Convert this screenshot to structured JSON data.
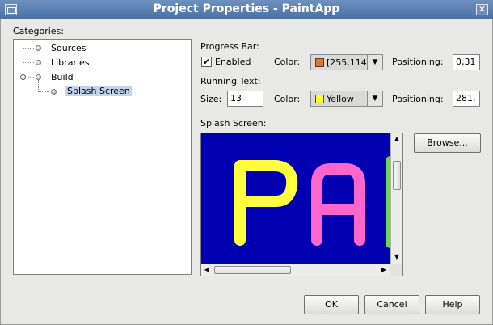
{
  "window": {
    "title": "Project Properties - PaintApp",
    "close_glyph": "✕"
  },
  "categories": {
    "label": "Categories:",
    "items": [
      {
        "label": "Sources"
      },
      {
        "label": "Libraries"
      },
      {
        "label": "Build"
      },
      {
        "label": "Splash Screen",
        "selected": true
      }
    ]
  },
  "progress_bar": {
    "section_label": "Progress Bar:",
    "enabled_label": "Enabled",
    "enabled": true,
    "check_glyph": "✔",
    "color_label": "Color:",
    "color_value": "[255,114,",
    "color_swatch": "#f07020",
    "positioning_label": "Positioning:",
    "positioning_value": "0,31"
  },
  "running_text": {
    "section_label": "Running Text:",
    "size_label": "Size:",
    "size_value": "13",
    "color_label": "Color:",
    "color_value": "Yellow",
    "color_swatch": "#ffff30",
    "positioning_label": "Positioning:",
    "positioning_value": "281,"
  },
  "splash_screen": {
    "section_label": "Splash Screen:",
    "browse_label": "Browse...",
    "image_bg": "#0000b0",
    "letter_colors": [
      "#ffff40",
      "#ff66cc",
      "#66dd44"
    ]
  },
  "footer": {
    "ok_label": "OK",
    "cancel_label": "Cancel",
    "help_label": "Help"
  },
  "icons": {
    "dropdown": "▼",
    "up": "▲",
    "down": "▼",
    "left": "◀",
    "right": "▶"
  }
}
